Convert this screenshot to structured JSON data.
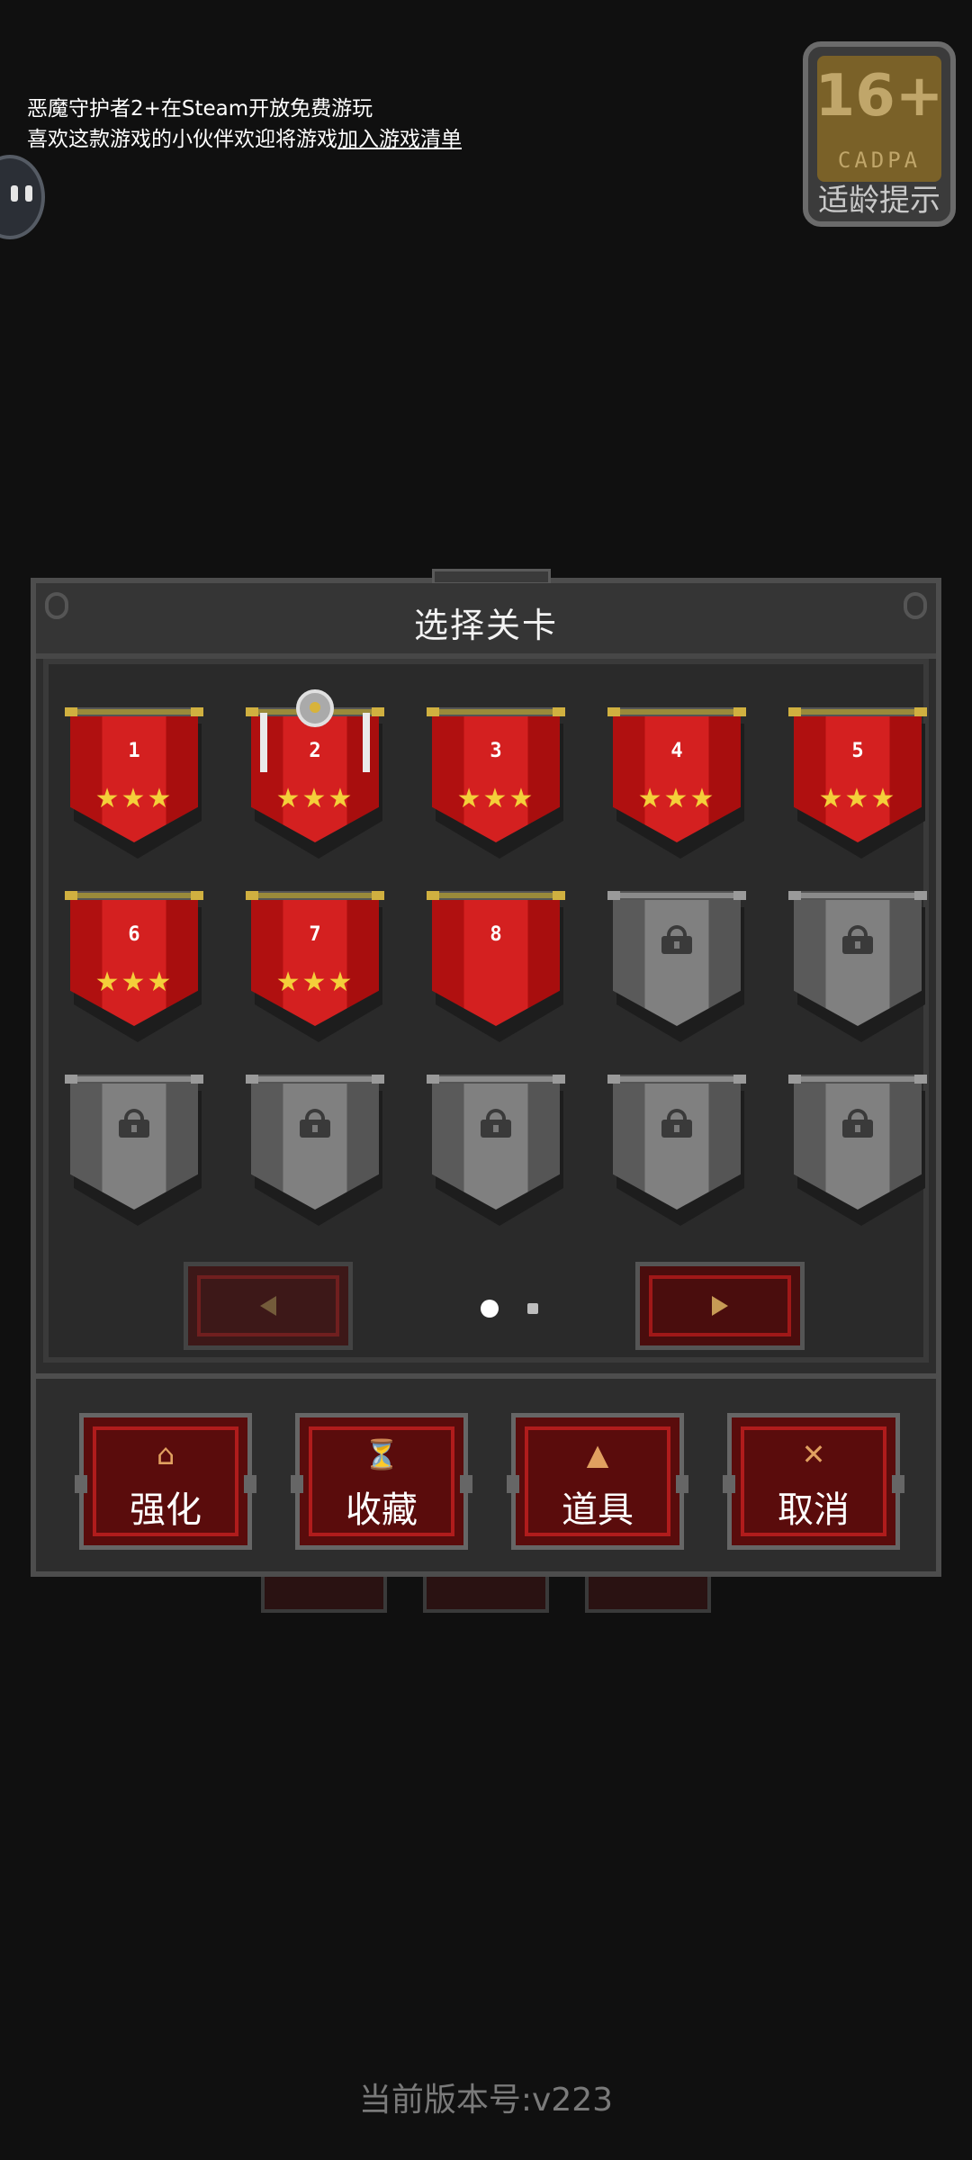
{
  "notice": {
    "line1": "恶魔守护者2+在Steam开放免费游玩",
    "line2_prefix": "喜欢这款游戏的小伙伴欢迎将游戏",
    "line2_link": "加入游戏清单"
  },
  "age_badge": {
    "rating": "16+",
    "org": "CADPA",
    "label": "适龄提示"
  },
  "dialog": {
    "title": "选择关卡",
    "levels": [
      {
        "num": "1",
        "stars": "★★★"
      },
      {
        "num": "2",
        "stars": "★★★"
      },
      {
        "num": "3",
        "stars": "★★★"
      },
      {
        "num": "4",
        "stars": "★★★"
      },
      {
        "num": "5",
        "stars": "★★★"
      },
      {
        "num": "6",
        "stars": "★★★"
      },
      {
        "num": "7",
        "stars": "★★★"
      },
      {
        "num": "8",
        "stars": ""
      }
    ],
    "locked_count": 7,
    "page": {
      "current": 1,
      "total": 2
    }
  },
  "actions": {
    "upgrade": {
      "label": "强化",
      "icon": "upgrade-icon"
    },
    "collection": {
      "label": "收藏",
      "icon": "trophy-icon"
    },
    "items": {
      "label": "道具",
      "icon": "potion-icon"
    },
    "cancel": {
      "label": "取消",
      "icon": "close-icon"
    }
  },
  "version": "当前版本号:v223",
  "colors": {
    "banner_red": "#d42020",
    "banner_locked": "#808080",
    "star": "#f4cf3a",
    "button_red": "#5a0c0c"
  }
}
